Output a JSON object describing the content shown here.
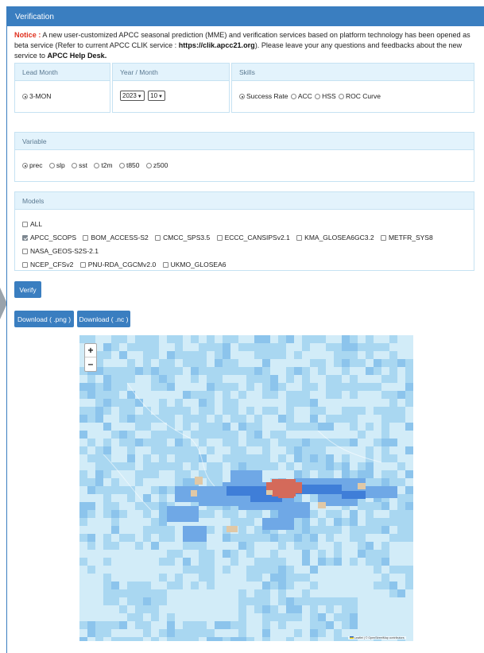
{
  "panel": {
    "title": "Verification"
  },
  "notice": {
    "label": "Notice :",
    "text1": " A new user-customized APCC seasonal prediction (MME) and verification services based on platform technology has been opened as beta service (Refer to current APCC CLIK service : ",
    "link": "https://clik.apcc21.org",
    "text2": "). Please leave your any questions and feedbacks about the new service to ",
    "helpdesk": "APCC Help Desk."
  },
  "lead_month": {
    "header": "Lead Month",
    "value": "3-MON"
  },
  "year_month": {
    "header": "Year / Month",
    "year": "2023",
    "month": "10"
  },
  "skills": {
    "header": "Skills",
    "options": [
      "Success Rate",
      "ACC",
      "HSS",
      "ROC Curve"
    ],
    "selected": "Success Rate"
  },
  "variable": {
    "header": "Variable",
    "options": [
      "prec",
      "slp",
      "sst",
      "t2m",
      "t850",
      "z500"
    ],
    "selected": "prec"
  },
  "models": {
    "header": "Models",
    "all_label": "ALL",
    "items": [
      "APCC_SCOPS",
      "BOM_ACCESS-S2",
      "CMCC_SPS3.5",
      "ECCC_CANSIPSv2.1",
      "KMA_GLOSEA6GC3.2",
      "METFR_SYS8",
      "NASA_GEOS-S2S-2.1",
      "NCEP_CFSv2",
      "PNU-RDA_CGCMv2.0",
      "UKMO_GLOSEA6"
    ],
    "checked": [
      "APCC_SCOPS"
    ]
  },
  "buttons": {
    "verify": "Verify",
    "download_png": "Download ( .png )",
    "download_nc": "Download ( .nc )"
  },
  "map": {
    "zoom_in": "+",
    "zoom_out": "–",
    "attribution_leaflet": "Leaflet",
    "attribution_sep": " | © ",
    "attribution_osm": "OpenStreetMap contributors",
    "colors": {
      "low": "#d2ecf8",
      "mid": "#a9d7f1",
      "high": "#6fa8e6",
      "higher": "#3f7ed8",
      "tan": "#e0c8a6",
      "red": "#d46a5a"
    }
  },
  "colors": {
    "accent": "#3a7ec0",
    "notice": "#e0301e",
    "box_header": "#e3f3fc"
  }
}
